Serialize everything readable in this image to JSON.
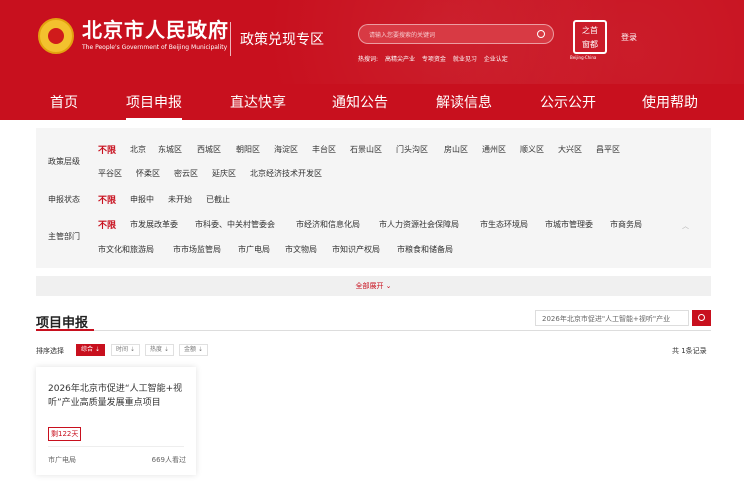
{
  "header": {
    "gov_title": "北京市人民政府",
    "gov_subtitle": "The People's Government of Beijing Municipality",
    "zone_title": "政策兑现专区",
    "search_placeholder": "请输入您要搜索的关键词",
    "hot_label": "热搜词:",
    "hot_words": [
      "高精尖产业",
      "专项资金",
      "就业见习",
      "企业认定"
    ],
    "seal_top": "首",
    "seal_bottom": "都",
    "seal_chars": [
      "之",
      "首",
      "窗",
      "都"
    ],
    "seal_subtitle": "Beijing·China",
    "login": "登录",
    "accent_color": "#c8101e"
  },
  "nav": [
    "首页",
    "项目申报",
    "直达快享",
    "通知公告",
    "解读信息",
    "公示公开",
    "使用帮助"
  ],
  "filters": {
    "level": {
      "label": "政策层级",
      "options": [
        "不限",
        "北京",
        "东城区",
        "西城区",
        "朝阳区",
        "海淀区",
        "丰台区",
        "石景山区",
        "门头沟区",
        "房山区",
        "通州区",
        "顺义区",
        "大兴区",
        "昌平区",
        "平谷区",
        "怀柔区",
        "密云区",
        "延庆区",
        "北京经济技术开发区"
      ]
    },
    "status": {
      "label": "申报状态",
      "options": [
        "不限",
        "申报中",
        "未开始",
        "已截止"
      ]
    },
    "dept": {
      "label": "主管部门",
      "options": [
        "不限",
        "市发展改革委",
        "市科委、中关村管委会",
        "市经济和信息化局",
        "市人力资源社会保障局",
        "市生态环境局",
        "市城市管理委",
        "市商务局",
        "市文化和旅游局",
        "市市场监管局",
        "市广电局",
        "市文物局",
        "市知识产权局",
        "市粮食和储备局"
      ]
    },
    "expand_all": "全部展开 ⌄"
  },
  "list": {
    "title": "项目申报",
    "search_value": "2026年北京市促进\"人工智能+视听\"产业",
    "sort_label": "排序选择",
    "sort_options": [
      "综合 ⇣",
      "时间 ⇣",
      "热度 ⇣",
      "金额 ⇣"
    ],
    "total": "共 1条记录",
    "cards": [
      {
        "title": "2026年北京市促进“人工智能+视听”产业高质量发展重点项目",
        "badge": "剩122天",
        "dept": "市广电局",
        "views": "669人看过"
      }
    ]
  }
}
